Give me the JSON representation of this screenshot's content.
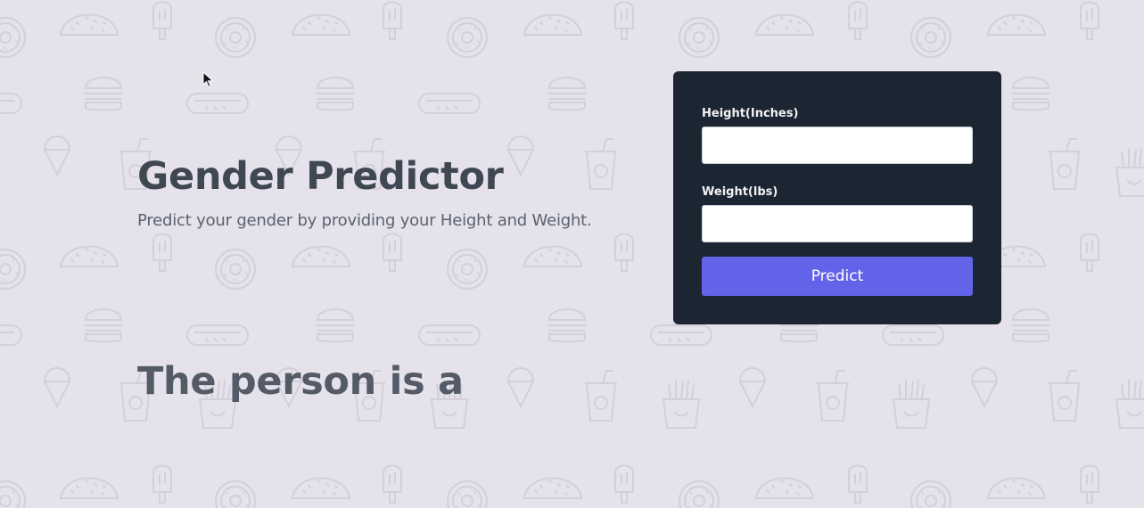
{
  "hero": {
    "title": "Gender Predictor",
    "subtitle": "Predict your gender by providing your Height and Weight."
  },
  "form": {
    "height_label": "Height(Inches)",
    "height_value": "",
    "weight_label": "Weight(lbs)",
    "weight_value": "",
    "submit_label": "Predict"
  },
  "result": {
    "text": "The person is a"
  },
  "colors": {
    "background": "#e5e2eb",
    "card": "#1c2633",
    "accent": "#6363e9",
    "heading": "#3f4753"
  },
  "background_pattern_icons": [
    "taco-icon",
    "popsicle-icon",
    "donut-icon",
    "burger-icon",
    "hotdog-icon",
    "ice-cream-cone-icon",
    "soda-cup-icon",
    "fries-icon"
  ]
}
